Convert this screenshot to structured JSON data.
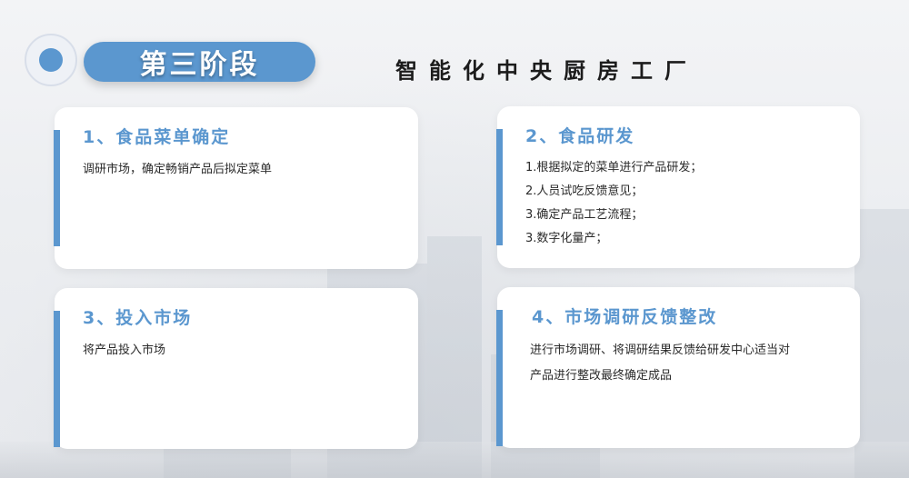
{
  "header": {
    "stage_label": "第三阶段",
    "main_title": "智能化中央厨房工厂"
  },
  "cards": [
    {
      "title": "1、食品菜单确定",
      "lines": [
        "调研市场，确定畅销产品后拟定菜单"
      ]
    },
    {
      "title": "2、食品研发",
      "lines": [
        "1.根据拟定的菜单进行产品研发；",
        "2.人员试吃反馈意见；",
        "3.确定产品工艺流程；",
        "3.数字化量产；"
      ]
    },
    {
      "title": "3、投入市场",
      "lines": [
        "将产品投入市场"
      ]
    },
    {
      "title": "4、市场调研反馈整改",
      "lines": [
        "进行市场调研、将调研结果反馈给研发中心适当对",
        "产品进行整改最终确定成品"
      ]
    }
  ],
  "colors": {
    "accent": "#5b97cf",
    "card_bg": "#ffffff",
    "text": "#2b2b2b"
  }
}
